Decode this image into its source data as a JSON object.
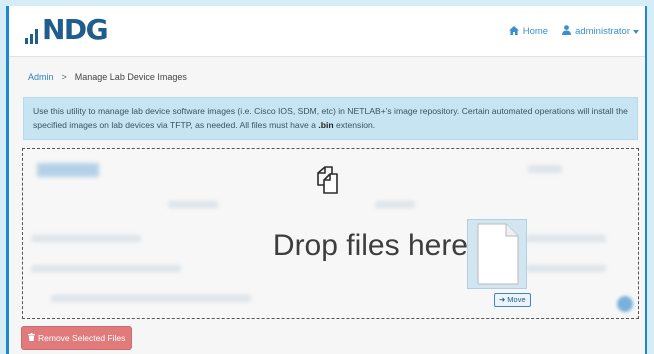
{
  "brand": {
    "logo_text": "NDG",
    "color": "#1f5d8f"
  },
  "nav": {
    "home_label": "Home",
    "home_icon": "home-icon",
    "user_label": "administrator",
    "user_icon": "user-icon",
    "link_color": "#3a8fd0"
  },
  "breadcrumb": {
    "root": "Admin",
    "separator": ">",
    "current": "Manage Lab Device Images"
  },
  "info": {
    "text_before": "Use this utility to manage lab device software images (i.e. Cisco IOS, SDM, etc) in NETLAB+'s image repository. Certain automated operations will install the specified images on lab devices via TFTP, as needed. All files must have a ",
    "ext": ".bin",
    "text_after": " extension."
  },
  "dropzone": {
    "prompt": "Drop files here",
    "move_label": "Move",
    "icon": "copy-files-icon",
    "ghost_icon": "file-icon"
  },
  "actions": {
    "remove_label": "Remove Selected Files",
    "remove_icon": "trash-icon",
    "remove_color": "#e07a7b"
  },
  "colors": {
    "frame_border": "#1f87d0",
    "alert_bg": "#c6e4f1"
  }
}
